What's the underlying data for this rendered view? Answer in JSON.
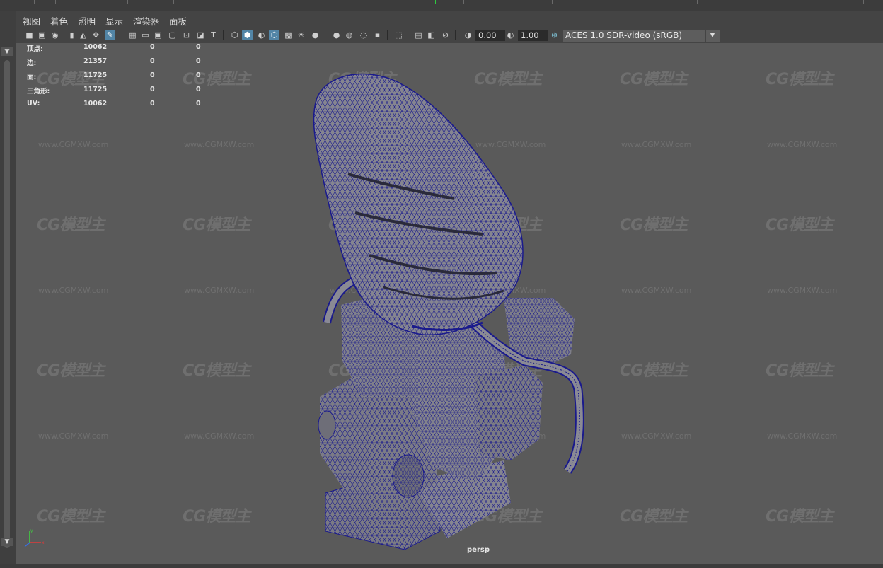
{
  "menu": {
    "items": [
      {
        "label": "视图"
      },
      {
        "label": "着色"
      },
      {
        "label": "照明"
      },
      {
        "label": "显示"
      },
      {
        "label": "渲染器"
      },
      {
        "label": "面板"
      }
    ]
  },
  "toolbar": {
    "exposure_value": "0.00",
    "gamma_value": "1.00",
    "color_space": "ACES 1.0 SDR-video (sRGB)"
  },
  "hud": {
    "rows": [
      {
        "label": "顶点:",
        "v1": "10062",
        "v2": "0",
        "v3": "0"
      },
      {
        "label": "边:",
        "v1": "21357",
        "v2": "0",
        "v3": "0"
      },
      {
        "label": "面:",
        "v1": "11725",
        "v2": "0",
        "v3": "0"
      },
      {
        "label": "三角形:",
        "v1": "11725",
        "v2": "0",
        "v3": "0"
      },
      {
        "label": "UV:",
        "v1": "10062",
        "v2": "0",
        "v3": "0"
      }
    ]
  },
  "viewport": {
    "camera": "persp",
    "watermark_logo": "CG模型主",
    "watermark_url": "www.CGMXW.com",
    "wire_color": "#1a1a8c",
    "mesh_color": "#7a7a84",
    "background_color": "#5a5a5a"
  },
  "axis": {
    "x": "x",
    "y": "y",
    "z": "z"
  }
}
